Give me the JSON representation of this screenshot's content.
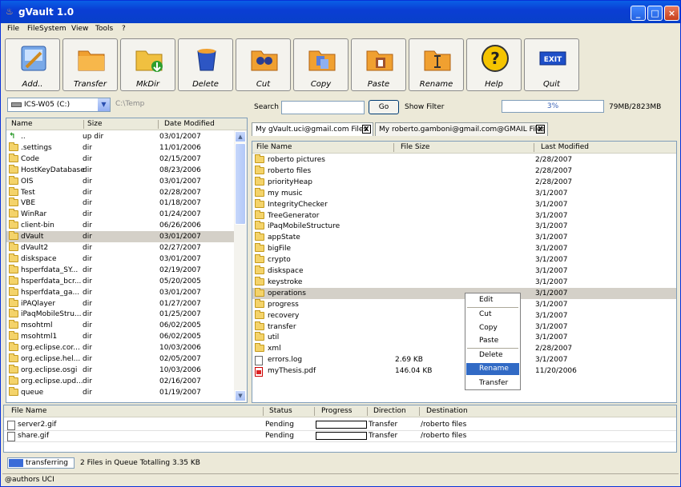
{
  "window": {
    "title": "gVault 1.0",
    "minimize": "_",
    "maximize": "□",
    "close": "×"
  },
  "menu": [
    "File",
    "FileSystem",
    "View",
    "Tools",
    "?"
  ],
  "toolbar": [
    {
      "label": "Add..",
      "icon": "add-icon"
    },
    {
      "label": "Transfer",
      "icon": "transfer-icon"
    },
    {
      "label": "MkDir",
      "icon": "mkdir-icon"
    },
    {
      "label": "Delete",
      "icon": "delete-icon"
    },
    {
      "label": "Cut",
      "icon": "cut-icon"
    },
    {
      "label": "Copy",
      "icon": "copy-icon"
    },
    {
      "label": "Paste",
      "icon": "paste-icon"
    },
    {
      "label": "Rename",
      "icon": "rename-icon"
    },
    {
      "label": "Help",
      "icon": "help-icon"
    },
    {
      "label": "Quit",
      "icon": "exit-icon",
      "icon_text": "EXIT"
    }
  ],
  "local": {
    "drive": "ICS-W05 (C:)",
    "path": "C:\\Temp",
    "columns": [
      "Name",
      "Size",
      "Date Modified"
    ],
    "rows": [
      {
        "name": "..",
        "size": "up dir",
        "date": "03/01/2007",
        "icon": "up-dir-icon"
      },
      {
        "name": ".settings",
        "size": "dir",
        "date": "11/01/2006"
      },
      {
        "name": "Code",
        "size": "dir",
        "date": "02/15/2007"
      },
      {
        "name": "HostKeyDatabase",
        "size": "dir",
        "date": "08/23/2006"
      },
      {
        "name": "OIS",
        "size": "dir",
        "date": "03/01/2007"
      },
      {
        "name": "Test",
        "size": "dir",
        "date": "02/28/2007"
      },
      {
        "name": "VBE",
        "size": "dir",
        "date": "01/18/2007"
      },
      {
        "name": "WinRar",
        "size": "dir",
        "date": "01/24/2007"
      },
      {
        "name": "client-bin",
        "size": "dir",
        "date": "06/26/2006"
      },
      {
        "name": "dVault",
        "size": "dir",
        "date": "03/01/2007",
        "selected": true
      },
      {
        "name": "dVault2",
        "size": "dir",
        "date": "02/27/2007"
      },
      {
        "name": "diskspace",
        "size": "dir",
        "date": "03/01/2007"
      },
      {
        "name": "hsperfdata_SY...",
        "size": "dir",
        "date": "02/19/2007"
      },
      {
        "name": "hsperfdata_bcr...",
        "size": "dir",
        "date": "05/20/2005"
      },
      {
        "name": "hsperfdata_ga...",
        "size": "dir",
        "date": "03/01/2007"
      },
      {
        "name": "iPAQlayer",
        "size": "dir",
        "date": "01/27/2007"
      },
      {
        "name": "iPaqMobileStru...",
        "size": "dir",
        "date": "01/25/2007"
      },
      {
        "name": "msohtml",
        "size": "dir",
        "date": "06/02/2005"
      },
      {
        "name": "msohtml1",
        "size": "dir",
        "date": "06/02/2005"
      },
      {
        "name": "org.eclipse.cor...",
        "size": "dir",
        "date": "10/03/2006"
      },
      {
        "name": "org.eclipse.hel...",
        "size": "dir",
        "date": "02/05/2007"
      },
      {
        "name": "org.eclipse.osgi",
        "size": "dir",
        "date": "10/03/2006"
      },
      {
        "name": "org.eclipse.upd...",
        "size": "dir",
        "date": "02/16/2007"
      },
      {
        "name": "queue",
        "size": "dir",
        "date": "01/19/2007"
      }
    ]
  },
  "search": {
    "label": "Search",
    "value": "",
    "go": "Go",
    "filter": "Show Filter"
  },
  "quota": {
    "percent": 3,
    "text": "3%",
    "usage": "79MB/2823MB"
  },
  "tabs": [
    {
      "label": "My gVault.uci@gmail.com Files",
      "close": "X"
    },
    {
      "label": "My roberto.gamboni@gmail.com@GMAIL Files",
      "close": "X"
    }
  ],
  "remote": {
    "columns": [
      "File Name",
      "File Size",
      "Last Modified"
    ],
    "rows": [
      {
        "name": "roberto pictures",
        "size": "",
        "date": "2/28/2007"
      },
      {
        "name": "roberto files",
        "size": "",
        "date": "2/28/2007"
      },
      {
        "name": "priorityHeap",
        "size": "",
        "date": "2/28/2007"
      },
      {
        "name": "my music",
        "size": "",
        "date": "3/1/2007"
      },
      {
        "name": "IntegrityChecker",
        "size": "",
        "date": "3/1/2007"
      },
      {
        "name": "TreeGenerator",
        "size": "",
        "date": "3/1/2007"
      },
      {
        "name": "iPaqMobileStructure",
        "size": "",
        "date": "3/1/2007"
      },
      {
        "name": "appState",
        "size": "",
        "date": "3/1/2007"
      },
      {
        "name": "bigFile",
        "size": "",
        "date": "3/1/2007"
      },
      {
        "name": "crypto",
        "size": "",
        "date": "3/1/2007"
      },
      {
        "name": "diskspace",
        "size": "",
        "date": "3/1/2007"
      },
      {
        "name": "keystroke",
        "size": "",
        "date": "3/1/2007"
      },
      {
        "name": "operations",
        "size": "",
        "date": "3/1/2007",
        "selected": true
      },
      {
        "name": "progress",
        "size": "",
        "date": "3/1/2007"
      },
      {
        "name": "recovery",
        "size": "",
        "date": "3/1/2007"
      },
      {
        "name": "transfer",
        "size": "",
        "date": "3/1/2007"
      },
      {
        "name": "util",
        "size": "",
        "date": "3/1/2007"
      },
      {
        "name": "xml",
        "size": "",
        "date": "2/28/2007"
      },
      {
        "name": "errors.log",
        "size": "2.69 KB",
        "date": "3/1/2007",
        "icon": "log-file-icon"
      },
      {
        "name": "myThesis.pdf",
        "size": "146.04 KB",
        "date": "11/20/2006",
        "icon": "pdf-file-icon"
      }
    ]
  },
  "context_menu": [
    "Edit",
    "Cut",
    "Copy",
    "Paste",
    "Delete",
    "Rename",
    "Transfer"
  ],
  "context_menu_highlighted": "Rename",
  "queue": {
    "columns": [
      "File Name",
      "Status",
      "Progress",
      "Direction",
      "Destination"
    ],
    "rows": [
      {
        "name": "server2.gif",
        "status": "Pending",
        "progress": 0,
        "direction": "Transfer",
        "destination": "/roberto files"
      },
      {
        "name": "share.gif",
        "status": "Pending",
        "progress": 0,
        "direction": "Transfer",
        "destination": "/roberto files"
      }
    ]
  },
  "status": {
    "transfer_label": "transferring",
    "summary": "2 Files in Queue Totalling 3.35 KB",
    "footer": "@authors UCI"
  },
  "colors": {
    "titlebar": "#0a3ed4",
    "selection": "#316ac5",
    "folder": "#f4d36a"
  }
}
